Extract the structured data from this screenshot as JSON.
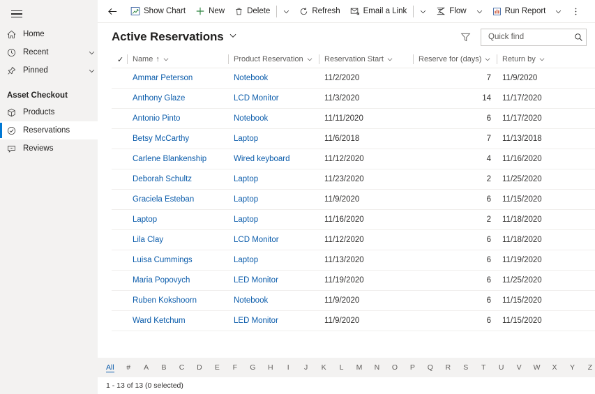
{
  "sidebar": {
    "hamburger_label": "site-map-toggle",
    "items": [
      {
        "label": "Home",
        "icon": "home-icon",
        "chevron": false,
        "selected": false
      },
      {
        "label": "Recent",
        "icon": "clock-icon",
        "chevron": true,
        "selected": false
      },
      {
        "label": "Pinned",
        "icon": "pin-icon",
        "chevron": true,
        "selected": false
      }
    ],
    "group_title": "Asset Checkout",
    "group_items": [
      {
        "label": "Products",
        "icon": "box-icon",
        "selected": false
      },
      {
        "label": "Reservations",
        "icon": "check-circle-icon",
        "selected": true
      },
      {
        "label": "Reviews",
        "icon": "comment-icon",
        "selected": false
      }
    ]
  },
  "commandbar": {
    "back_label": "back-arrow-icon",
    "items": [
      {
        "label": "Show Chart",
        "icon": "chart-icon",
        "caret": false,
        "divider_after": false
      },
      {
        "label": "New",
        "icon": "plus-icon",
        "caret": false,
        "divider_after": false
      },
      {
        "label": "Delete",
        "icon": "trash-icon",
        "caret": true,
        "divider_after": true
      },
      {
        "label": "Refresh",
        "icon": "refresh-icon",
        "caret": false,
        "divider_after": false
      },
      {
        "label": "Email a Link",
        "icon": "email-icon",
        "caret": true,
        "divider_after": true
      },
      {
        "label": "Flow",
        "icon": "flow-icon",
        "caret": true,
        "divider_after": false
      },
      {
        "label": "Run Report",
        "icon": "report-icon",
        "caret": true,
        "divider_after": false
      }
    ],
    "overflow_label": "more-commands"
  },
  "view": {
    "title": "Active Reservations",
    "filter_icon": "filter-icon",
    "search": {
      "placeholder": "Quick find",
      "value": "",
      "icon": "search-icon"
    }
  },
  "grid": {
    "columns": [
      {
        "label": "Name",
        "sorted": true,
        "sort_arrow": "↑",
        "align": "left"
      },
      {
        "label": "Product Reservation",
        "sorted": false,
        "sort_arrow": "",
        "align": "left"
      },
      {
        "label": "Reservation Start",
        "sorted": false,
        "sort_arrow": "",
        "align": "left"
      },
      {
        "label": "Reserve for (days)",
        "sorted": false,
        "sort_arrow": "",
        "align": "right"
      },
      {
        "label": "Return by",
        "sorted": false,
        "sort_arrow": "",
        "align": "left"
      }
    ],
    "rows": [
      {
        "name": "Ammar Peterson",
        "product": "Notebook",
        "start": "11/2/2020",
        "days": "7",
        "return": "11/9/2020"
      },
      {
        "name": "Anthony Glaze",
        "product": "LCD Monitor",
        "start": "11/3/2020",
        "days": "14",
        "return": "11/17/2020"
      },
      {
        "name": "Antonio Pinto",
        "product": "Notebook",
        "start": "11/11/2020",
        "days": "6",
        "return": "11/17/2020"
      },
      {
        "name": "Betsy McCarthy",
        "product": "Laptop",
        "start": "11/6/2018",
        "days": "7",
        "return": "11/13/2018"
      },
      {
        "name": "Carlene Blankenship",
        "product": "Wired keyboard",
        "start": "11/12/2020",
        "days": "4",
        "return": "11/16/2020"
      },
      {
        "name": "Deborah Schultz",
        "product": "Laptop",
        "start": "11/23/2020",
        "days": "2",
        "return": "11/25/2020"
      },
      {
        "name": "Graciela Esteban",
        "product": "Laptop",
        "start": "11/9/2020",
        "days": "6",
        "return": "11/15/2020"
      },
      {
        "name": "Laptop",
        "product": "Laptop",
        "start": "11/16/2020",
        "days": "2",
        "return": "11/18/2020"
      },
      {
        "name": "Lila Clay",
        "product": "LCD Monitor",
        "start": "11/12/2020",
        "days": "6",
        "return": "11/18/2020"
      },
      {
        "name": "Luisa Cummings",
        "product": "Laptop",
        "start": "11/13/2020",
        "days": "6",
        "return": "11/19/2020"
      },
      {
        "name": "Maria Popovych",
        "product": "LED Monitor",
        "start": "11/19/2020",
        "days": "6",
        "return": "11/25/2020"
      },
      {
        "name": "Ruben Kokshoorn",
        "product": "Notebook",
        "start": "11/9/2020",
        "days": "6",
        "return": "11/15/2020"
      },
      {
        "name": "Ward Ketchum",
        "product": "LED Monitor",
        "start": "11/9/2020",
        "days": "6",
        "return": "11/15/2020"
      }
    ]
  },
  "alphabet_bar": {
    "active": "All",
    "items": [
      "All",
      "#",
      "A",
      "B",
      "C",
      "D",
      "E",
      "F",
      "G",
      "H",
      "I",
      "J",
      "K",
      "L",
      "M",
      "N",
      "O",
      "P",
      "Q",
      "R",
      "S",
      "T",
      "U",
      "V",
      "W",
      "X",
      "Y",
      "Z"
    ]
  },
  "footer": {
    "status": "1 - 13 of 13 (0 selected)"
  },
  "colors": {
    "accent": "#0078d4",
    "link": "#0b5cab",
    "sidebar_bg": "#f3f2f1",
    "text": "#201f1e",
    "muted": "#605e5c",
    "divider": "#edebe9",
    "plus_green": "#2e8540"
  }
}
